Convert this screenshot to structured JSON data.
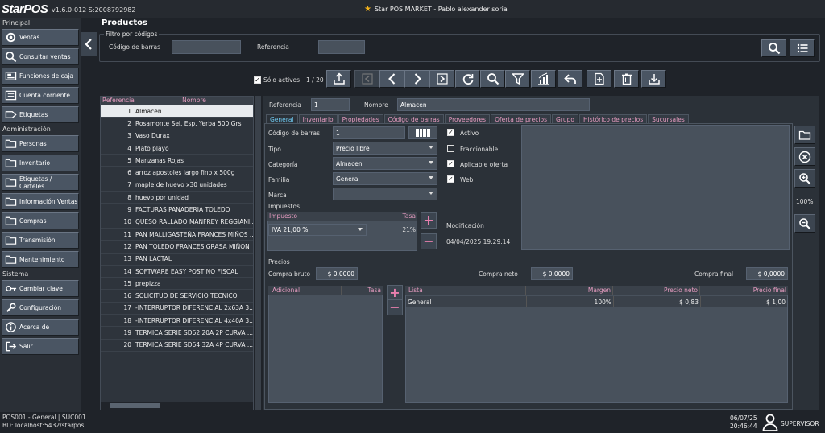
{
  "app": {
    "logo": "StarPOS",
    "version": "v1.6.0-012 S:2008792982",
    "window_title": "Star POS MARKET - Pablo alexander soria"
  },
  "sidebar": {
    "sections": [
      "Principal",
      "Administración",
      "Sistema"
    ],
    "principal": [
      {
        "label": "Ventas",
        "icon": "gear-icon"
      },
      {
        "label": "Consultar ventas",
        "icon": "search-icon"
      },
      {
        "label": "Funciones de caja",
        "icon": "cash-register-icon"
      },
      {
        "label": "Cuenta corriente",
        "icon": "account-icon"
      },
      {
        "label": "Etiquetas",
        "icon": "tag-icon"
      }
    ],
    "administracion": [
      {
        "label": "Personas",
        "icon": "folder-icon"
      },
      {
        "label": "Inventario",
        "icon": "folder-icon"
      },
      {
        "label": "Etiquetas / Carteles",
        "icon": "folder-icon"
      },
      {
        "label": "Información Ventas",
        "icon": "folder-icon"
      },
      {
        "label": "Compras",
        "icon": "folder-icon"
      },
      {
        "label": "Transmisión",
        "icon": "folder-icon"
      },
      {
        "label": "Mantenimiento",
        "icon": "folder-icon"
      }
    ],
    "sistema": [
      {
        "label": "Cambiar clave",
        "icon": "key-icon"
      },
      {
        "label": "Configuración",
        "icon": "wrench-icon"
      },
      {
        "label": "Acerca de",
        "icon": "info-icon"
      },
      {
        "label": "Salir",
        "icon": "exit-icon"
      }
    ]
  },
  "status": {
    "line1": "POS001 - General | SUC001",
    "line2": "BD: localhost:5432/starpos"
  },
  "user": {
    "date": "06/07/25",
    "time": "20:46:44",
    "role": "SUPERVISOR"
  },
  "main": {
    "title": "Productos",
    "filter": {
      "legend": "Filtro por códigos",
      "barcode_label": "Código de barras",
      "barcode_value": "",
      "reference_label": "Referencia",
      "reference_value": ""
    },
    "toolbar": {
      "only_active_label": "Sólo activos",
      "only_active_checked": true,
      "page_indicator": "1 / 20"
    }
  },
  "list": {
    "columns": [
      "Referencia",
      "Nombre"
    ],
    "rows": [
      {
        "ref": "1",
        "name": "Almacen"
      },
      {
        "ref": "2",
        "name": "Rosamonte Sel. Esp. Yerba 500 Grs"
      },
      {
        "ref": "3",
        "name": "Vaso Durax"
      },
      {
        "ref": "4",
        "name": "Plato playo"
      },
      {
        "ref": "5",
        "name": "Manzanas Rojas"
      },
      {
        "ref": "6",
        "name": "arroz apostoles largo fino x 500g"
      },
      {
        "ref": "7",
        "name": "maple de huevo x30 unidades"
      },
      {
        "ref": "8",
        "name": "huevo por unidad"
      },
      {
        "ref": "9",
        "name": "FACTURAS PANADERIA TOLEDO"
      },
      {
        "ref": "10",
        "name": "QUESO RALLADO MANFREY REGGIANI..."
      },
      {
        "ref": "11",
        "name": "PAN MALLIGASTEÑA FRANCES MIÑOS ..."
      },
      {
        "ref": "12",
        "name": "PAN TOLEDO FRANCES GRASA MIÑON"
      },
      {
        "ref": "13",
        "name": "PAN LACTAL"
      },
      {
        "ref": "14",
        "name": "SOFTWARE EASY POST NO FISCAL"
      },
      {
        "ref": "15",
        "name": "prepizza"
      },
      {
        "ref": "16",
        "name": "SOLICITUD DE SERVICIO TECNICO"
      },
      {
        "ref": "17",
        "name": "-INTERRUPTOR DIFERENCIAL 2x63A 3..."
      },
      {
        "ref": "18",
        "name": "-INTERRUPTOR DIFERENCIAL 4x40A 3..."
      },
      {
        "ref": "19",
        "name": "TERMICA SERIE SD62 20A 2P CURVA ..."
      },
      {
        "ref": "20",
        "name": "TERMICA SERIE SD64 32A 4P CURVA ..."
      }
    ]
  },
  "detail": {
    "reference_label": "Referencia",
    "reference_value": "1",
    "name_label": "Nombre",
    "name_value": "Almacen",
    "tabs": [
      "General",
      "Inventario",
      "Propiedades",
      "Código de barras",
      "Proveedores",
      "Oferta de precios",
      "Grupo",
      "Histórico de precios",
      "Sucursales"
    ],
    "general": {
      "barcode_label": "Código de barras",
      "barcode_value": "1",
      "type_label": "Tipo",
      "type_value": "Precio libre",
      "category_label": "Categoría",
      "category_value": "Almacen",
      "family_label": "Familia",
      "family_value": "General",
      "brand_label": "Marca",
      "brand_value": "",
      "active_label": "Activo",
      "fractional_label": "Fraccionable",
      "offer_label": "Aplicable oferta",
      "web_label": "Web",
      "taxes_legend": "Impuestos",
      "tax_cols": [
        "Impuesto",
        "Tasa"
      ],
      "tax_row": {
        "name": "IVA 21,00 %",
        "rate": "21%"
      },
      "modification_label": "Modificación",
      "modification_value": "04/04/2025 19:29:14",
      "zoom": "100%",
      "prices_legend": "Precios",
      "gross_purchase_label": "Compra bruto",
      "gross_purchase_value": "$ 0,0000",
      "net_purchase_label": "Compra neto",
      "net_purchase_value": "$ 0,0000",
      "final_purchase_label": "Compra final",
      "final_purchase_value": "$ 0,0000",
      "extra_cols": [
        "Adicional",
        "Tasa"
      ],
      "price_cols": [
        "Lista",
        "Margen",
        "Precio neto",
        "Precio final"
      ],
      "price_row": {
        "list": "General",
        "margin": "100%",
        "net": "$ 0,83",
        "final": "$ 1,00"
      }
    }
  },
  "colors": {
    "accent_pink": "#e69cc0",
    "tab_active_blue": "#6ec9f0",
    "star": "#f5b31b"
  }
}
